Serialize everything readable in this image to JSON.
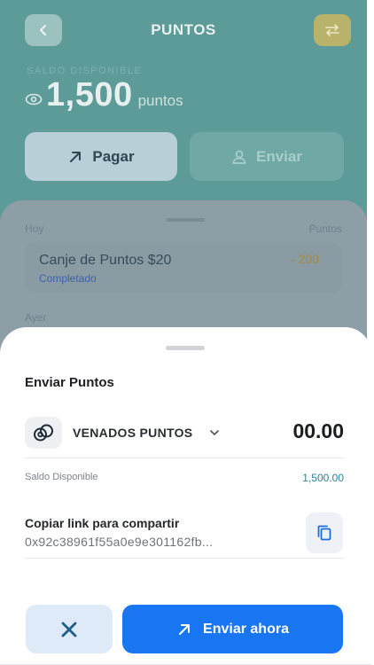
{
  "header": {
    "title": "PUNTOS",
    "back_icon": "chevron-left-icon",
    "swap_icon": "swap-arrows-icon"
  },
  "balance": {
    "label": "SALDO DISPONIBLE",
    "value": "1,500",
    "unit": "puntos"
  },
  "actions": {
    "pay_label": "Pagar",
    "send_label": "Enviar"
  },
  "activity": {
    "today_label": "Hoy",
    "points_header": "Puntos",
    "transactions": [
      {
        "title": "Canje de Puntos $20",
        "status": "Completado",
        "amount": "- 200"
      }
    ],
    "yesterday_label": "Ayer"
  },
  "sheet": {
    "title": "Enviar Puntos",
    "token_name": "VENADOS PUNTOS",
    "amount_value": "00.00",
    "available_label": "Saldo Disponible",
    "available_value": "1,500.00",
    "link_label": "Copiar link para compartir",
    "link_address": "0x92c38961f55a0e9e301162fb...",
    "send_now_label": "Enviar ahora"
  },
  "colors": {
    "primary": "#1976f2",
    "header_bg": "#5c9b98",
    "accent_text": "#2f7f9c"
  }
}
